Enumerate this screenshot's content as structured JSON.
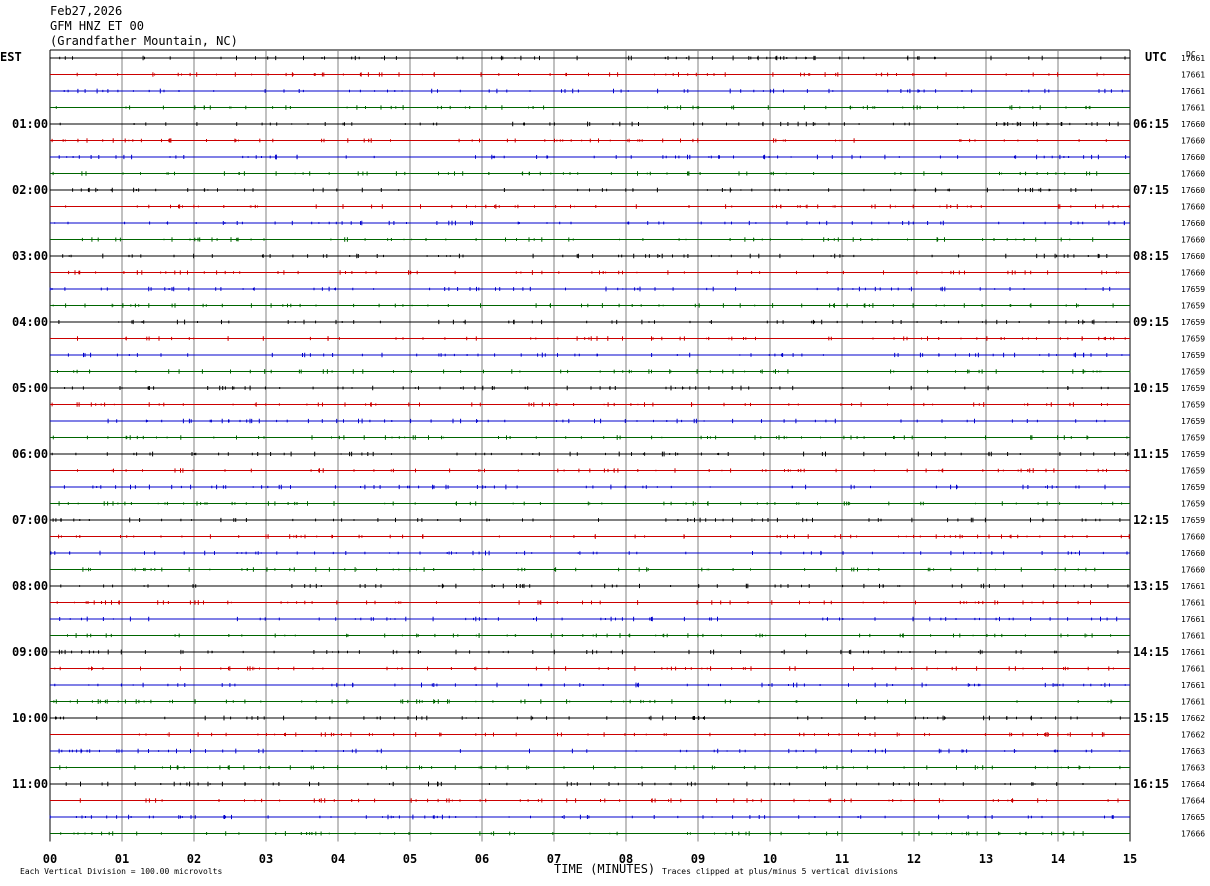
{
  "header": {
    "date": "Feb27,2026",
    "station": "GFM HNZ ET 00",
    "location": "(Grandfather Mountain, NC)"
  },
  "labels": {
    "left_timezone": "EST",
    "right_timezone": "UTC",
    "dc": "DC"
  },
  "footer": {
    "scale": "Each Vertical Division =  100.00 microvolts",
    "xlabel": "TIME (MINUTES)",
    "clip": "Traces clipped at plus/minus 5 vertical divisions"
  },
  "colors": {
    "trace_cycle": [
      "#000000",
      "#cc0000",
      "#0000cc",
      "#006600"
    ],
    "grid": "#808080",
    "minute_line": "#0000aa"
  },
  "chart_data": {
    "type": "line",
    "title": "",
    "xlabel": "TIME (MINUTES)",
    "xlim": [
      0,
      15
    ],
    "x_ticks": [
      "00",
      "01",
      "02",
      "03",
      "04",
      "05",
      "06",
      "07",
      "08",
      "09",
      "10",
      "11",
      "12",
      "13",
      "14",
      "15"
    ],
    "left_hour_labels": [
      "01:00",
      "02:00",
      "03:00",
      "04:00",
      "05:00",
      "06:00",
      "07:00",
      "08:00",
      "09:00",
      "10:00",
      "11:00"
    ],
    "right_hour_labels": [
      "06:15",
      "07:15",
      "08:15",
      "09:15",
      "10:15",
      "11:15",
      "12:15",
      "13:15",
      "14:15",
      "15:15",
      "16:15"
    ],
    "trace_count": 48,
    "dc_offsets": [
      "17661",
      "17661",
      "17661",
      "17661",
      "17660",
      "17660",
      "17660",
      "17660",
      "17660",
      "17660",
      "17660",
      "17660",
      "17660",
      "17660",
      "17659",
      "17659",
      "17659",
      "17659",
      "17659",
      "17659",
      "17659",
      "17659",
      "17659",
      "17659",
      "17659",
      "17659",
      "17659",
      "17659",
      "17659",
      "17660",
      "17660",
      "17660",
      "17661",
      "17661",
      "17661",
      "17661",
      "17661",
      "17661",
      "17661",
      "17661",
      "17662",
      "17662",
      "17663",
      "17663",
      "17664",
      "17664",
      "17665",
      "17666"
    ]
  }
}
